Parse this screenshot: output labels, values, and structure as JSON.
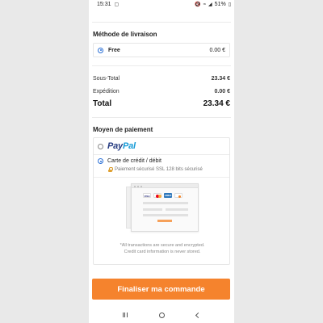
{
  "status_bar": {
    "time": "15:31",
    "battery": "51%",
    "icons": [
      "mute-icon",
      "wifi-icon",
      "signal-icon",
      "battery-icon"
    ]
  },
  "shipping": {
    "title": "Méthode de livraison",
    "options": [
      {
        "name": "Free",
        "price": "0.00 €",
        "selected": true
      }
    ]
  },
  "summary": {
    "subtotal_label": "Sous-Total",
    "subtotal_value": "23.34 €",
    "shipping_label": "Expédition",
    "shipping_value": "0.00 €",
    "total_label": "Total",
    "total_value": "23.34 €"
  },
  "payment": {
    "title": "Moyen de paiement",
    "paypal": {
      "logo_part1": "Pay",
      "logo_part2": "Pal",
      "selected": false
    },
    "card": {
      "label": "Carte de crédit / débit",
      "security": "Paiement sécurisé SSL 128 bits sécurisé",
      "selected": true
    },
    "card_logos": [
      "VISA",
      "mastercard",
      "AMEX",
      "discover"
    ],
    "note_line1": "*All transactions are secure and encrypted.",
    "note_line2": "Credit card information is never stored."
  },
  "checkout_button": "Finaliser ma commande",
  "colors": {
    "accent": "#f5832d",
    "radio": "#2a6fd6",
    "paypal_dark": "#253b80",
    "paypal_light": "#179bd7"
  }
}
